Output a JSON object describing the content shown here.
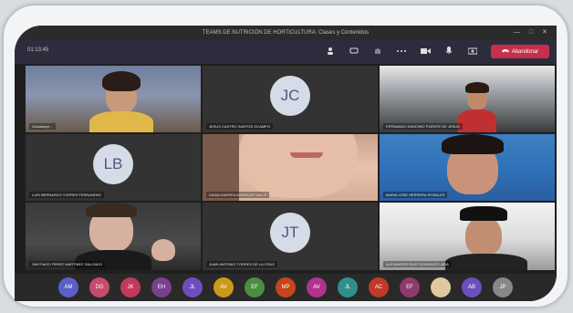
{
  "window": {
    "title": "TEAMS DE NUTRICIÓN DE HORTICULTURA: Clases y Contenidos",
    "controls": [
      "—",
      "□",
      "✕"
    ]
  },
  "toolbar": {
    "timer": "01:13:45",
    "icons": [
      "camera-icon",
      "mic-icon",
      "share-icon",
      "more-icon",
      "chat-icon",
      "participants-icon",
      "raise-hand-icon"
    ],
    "leave_label": "Abandonar",
    "leave_color": "#c4314b"
  },
  "tiles": [
    {
      "name": "Guadalupe...",
      "type": "video"
    },
    {
      "name": "JESUS CASTRO SANTOS OCAMPO",
      "initials": "JC",
      "type": "avatar"
    },
    {
      "name": "FERNANDO SANCHEZ PUENTE DE JESUS",
      "type": "video"
    },
    {
      "name": "LUIS BERNARDO TORRES FERNANDEZ",
      "initials": "LB",
      "type": "avatar"
    },
    {
      "name": "DIANA ANDREA MORALES VALLE",
      "type": "video"
    },
    {
      "name": "MARIA JOSE HERRERA ROSALES",
      "type": "video"
    },
    {
      "name": "SANTIAGO PEREZ MARTINEZ SALGADO",
      "type": "video"
    },
    {
      "name": "JUAN ANTONIO TORRES DE LA CRUZ",
      "initials": "JT",
      "type": "avatar"
    },
    {
      "name": "ALEJANDRO RUIZ GONZALEZ LARA",
      "type": "video"
    }
  ],
  "dock": {
    "avatars": [
      {
        "label": "AM",
        "color": "#5b5fc7"
      },
      {
        "label": "DG",
        "color": "#c84a6c"
      },
      {
        "label": "JK",
        "color": "#c2395b"
      },
      {
        "label": "EH",
        "color": "#7b3f8f"
      },
      {
        "label": "JL",
        "color": "#6b4fc0"
      },
      {
        "label": "AV",
        "color": "#c89b1a"
      },
      {
        "label": "EF",
        "color": "#4a8f3f"
      },
      {
        "label": "MP",
        "color": "#c8441a"
      },
      {
        "label": "AV",
        "color": "#b4328f"
      },
      {
        "label": "JL",
        "color": "#2f8f8f"
      },
      {
        "label": "AC",
        "color": "#c0392b"
      },
      {
        "label": "EF",
        "color": "#8f3a6b"
      },
      {
        "label": "",
        "color": "#e0c9a0"
      },
      {
        "label": "AB",
        "color": "#6a4fbf"
      },
      {
        "label": "JP",
        "color": "#888888"
      }
    ]
  }
}
